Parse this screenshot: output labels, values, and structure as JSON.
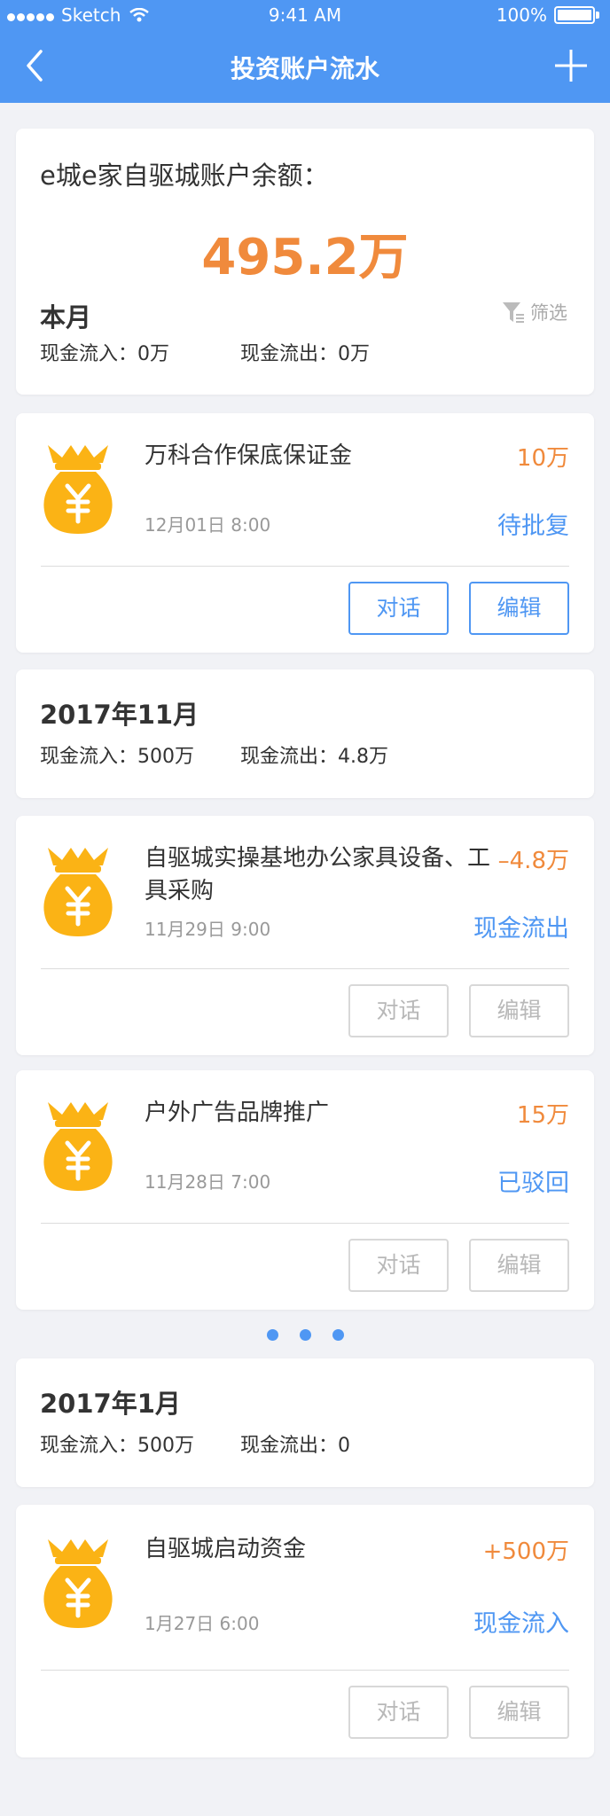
{
  "status_bar": {
    "carrier": "Sketch",
    "time": "9:41 AM",
    "battery": "100%"
  },
  "nav": {
    "title": "投资账户流水"
  },
  "summary": {
    "label": "e城e家自驱城账户余额：",
    "amount": "495.2万",
    "period": "本月",
    "filter_label": "筛选",
    "inflow": "现金流入：0万",
    "outflow": "现金流出：0万"
  },
  "transactions_top": [
    {
      "title": "万科合作保底保证金",
      "amount": "10万",
      "time": "12月01日 8:00",
      "status": "待批复",
      "talk": "对话",
      "edit": "编辑",
      "buttons_active": true
    }
  ],
  "month_nov": {
    "title": "2017年11月",
    "inflow": "现金流入：500万",
    "outflow": "现金流出：4.8万",
    "transactions": [
      {
        "title": "自驱城实操基地办公家具设备、工具采购",
        "amount": "–4.8万",
        "time": "11月29日 9:00",
        "status": "现金流出",
        "talk": "对话",
        "edit": "编辑",
        "buttons_active": false
      },
      {
        "title": "户外广告品牌推广",
        "amount": "15万",
        "time": "11月28日 7:00",
        "status": "已驳回",
        "talk": "对话",
        "edit": "编辑",
        "buttons_active": false
      }
    ]
  },
  "month_jan": {
    "title": "2017年1月",
    "inflow": "现金流入：500万",
    "outflow": "现金流出：0",
    "transactions": [
      {
        "title": "自驱城启动资金",
        "amount": "+500万",
        "time": "1月27日 6:00",
        "status": "现金流入",
        "talk": "对话",
        "edit": "编辑",
        "buttons_active": false
      }
    ]
  },
  "colors": {
    "primary": "#4f97f3",
    "amount": "#f08a3c",
    "bag": "#fbb315",
    "background": "#f1f2f6"
  },
  "icons": [
    "back-arrow-icon",
    "plus-icon",
    "filter-icon",
    "money-bag-icon",
    "wifi-icon",
    "battery-icon"
  ]
}
